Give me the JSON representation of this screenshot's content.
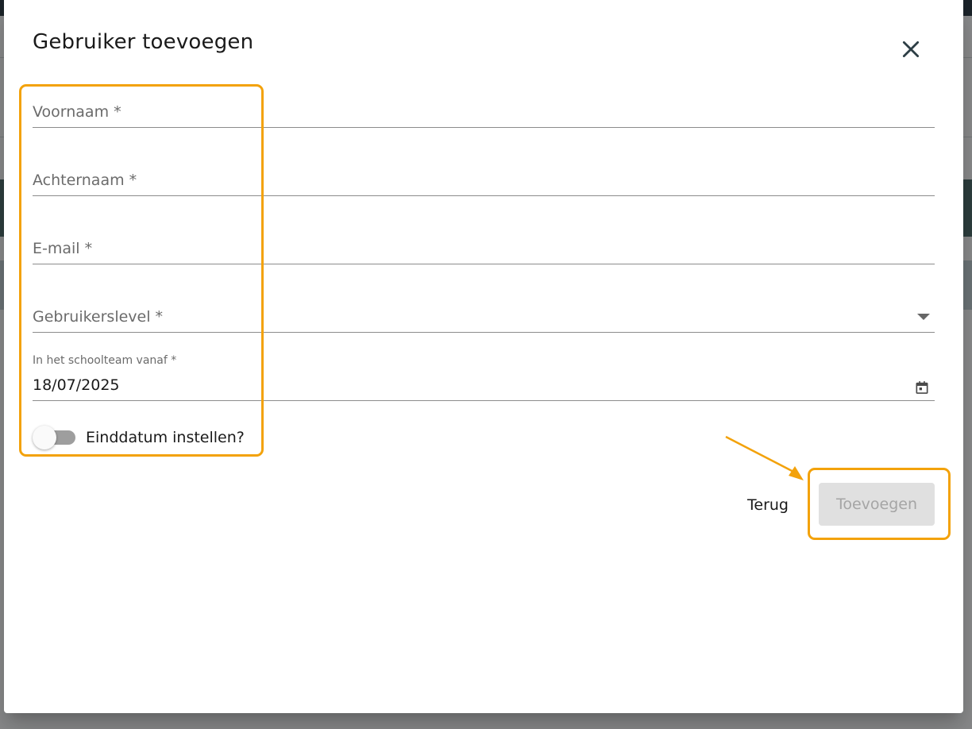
{
  "dialog": {
    "title": "Gebruiker toevoegen",
    "close_icon": "close-icon"
  },
  "form": {
    "first_name": {
      "label": "Voornaam *",
      "value": ""
    },
    "last_name": {
      "label": "Achternaam *",
      "value": ""
    },
    "email": {
      "label": "E-mail *",
      "value": ""
    },
    "user_level": {
      "label": "Gebruikerslevel *",
      "selected": "",
      "icon": "chevron-down-icon"
    },
    "start_date": {
      "label": "In het schoolteam vanaf *",
      "value": "18/07/2025",
      "icon": "calendar-icon"
    },
    "end_date_toggle": {
      "label": "Einddatum instellen?",
      "checked": false
    }
  },
  "actions": {
    "back_label": "Terug",
    "add_label": "Toevoegen",
    "add_disabled": true
  },
  "annotations": {
    "highlight_color": "#f3a20b"
  },
  "colors": {
    "dialog_bg": "#ffffff",
    "text": "#1a1a1a",
    "muted_label": "#6b6b6b",
    "disabled_button_bg": "#e0e0e0",
    "disabled_button_text": "#a5a5a5",
    "toggle_track": "#9e9e9e"
  }
}
